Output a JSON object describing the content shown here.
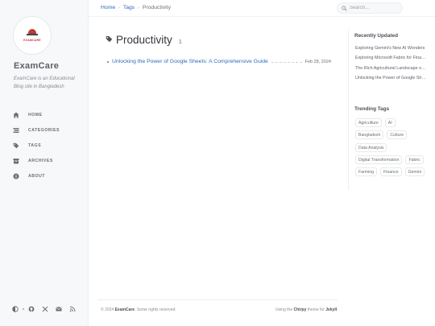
{
  "sidebar": {
    "logo_text": "EXAMCARE",
    "site_title": "ExamCare",
    "site_subtitle": "ExamCare is an Educational Blog site in Bangladesh",
    "nav": [
      {
        "label": "HOME",
        "icon": "home-icon"
      },
      {
        "label": "CATEGORIES",
        "icon": "stream-icon"
      },
      {
        "label": "TAGS",
        "icon": "tags-icon"
      },
      {
        "label": "ARCHIVES",
        "icon": "archive-icon"
      },
      {
        "label": "ABOUT",
        "icon": "info-icon"
      }
    ],
    "footer_icons": [
      "theme-toggle-icon",
      "github-icon",
      "twitter-icon",
      "email-icon",
      "rss-icon"
    ]
  },
  "breadcrumb": {
    "home": "Home",
    "tags": "Tags",
    "current": "Productivity"
  },
  "search": {
    "placeholder": "Search..."
  },
  "main": {
    "title": "Productivity",
    "count": "1",
    "posts": [
      {
        "title": "Unlocking the Power of Google Sheets: A Comprehensive Guide",
        "date": "Feb 28, 2024"
      }
    ]
  },
  "panel": {
    "recent_title": "Recently Updated",
    "recent": [
      "Exploring Gemini's New AI Wonders",
      "Exploring Microsoft Fabric for Financial Analysis",
      "The Rich Agricultural Landscape of Bangladesh",
      "Unlocking the Power of Google Sheets"
    ],
    "trending_title": "Trending Tags",
    "tags": [
      "Agriculture",
      "AI",
      "Bangladesh",
      "Culture",
      "Data Analysis",
      "Digital Transformation",
      "Fabric",
      "Farming",
      "Finance",
      "Gemini"
    ]
  },
  "footer": {
    "copyright_prefix": "© 2024",
    "copyright_owner": "ExamCare",
    "copyright_suffix": ". Some rights reserved.",
    "using_prefix": "Using the",
    "theme": "Chirpy",
    "theme_for": "theme for",
    "jekyll": "Jekyll",
    "period": "."
  },
  "colors": {
    "link": "#2a6cbd",
    "sidebar_bg": "#f6f8fa",
    "brand_red": "#c0392b"
  }
}
